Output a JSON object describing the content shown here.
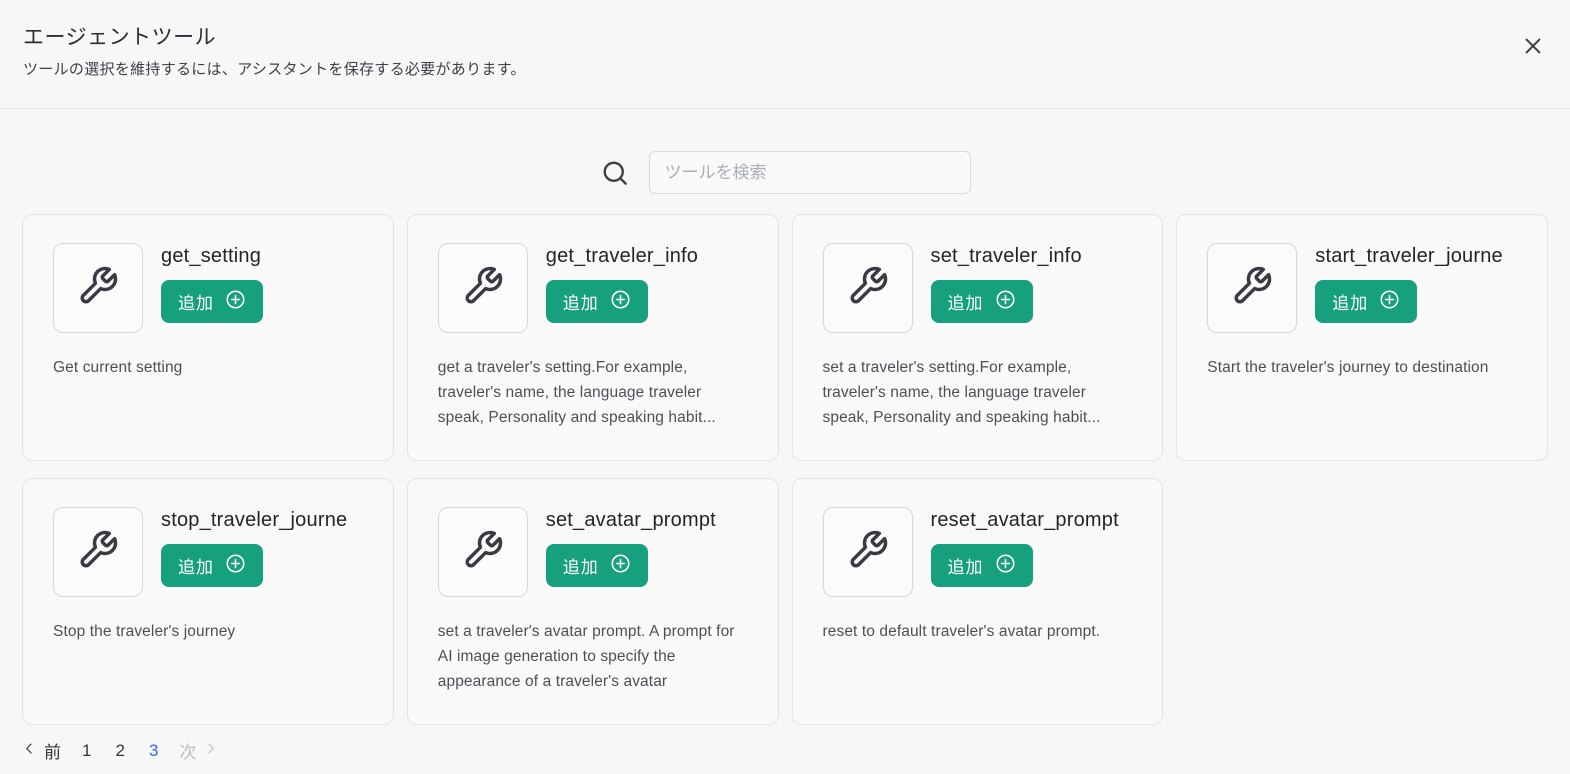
{
  "modal": {
    "title": "エージェントツール",
    "subtitle": "ツールの選択を維持するには、アシスタントを保存する必要があります。"
  },
  "search": {
    "placeholder": "ツールを検索"
  },
  "card": {
    "add_button_label": "追加"
  },
  "tools": [
    {
      "name": "get_setting",
      "description": "Get current setting"
    },
    {
      "name": "get_traveler_info",
      "description": "get a traveler's setting.For example, traveler's name, the language traveler speak, Personality and speaking habit..."
    },
    {
      "name": "set_traveler_info",
      "description": "set a traveler's setting.For example, traveler's name, the language traveler speak, Personality and speaking habit..."
    },
    {
      "name": "start_traveler_journe",
      "description": "Start the traveler's journey to destination"
    },
    {
      "name": "stop_traveler_journe",
      "description": "Stop the traveler's journey"
    },
    {
      "name": "set_avatar_prompt",
      "description": "set a traveler's avatar prompt. A prompt for AI image generation to specify the appearance of a traveler's avatar"
    },
    {
      "name": "reset_avatar_prompt",
      "description": "reset to default traveler's avatar prompt."
    }
  ],
  "pagination": {
    "prev_label": "前",
    "next_label": "次",
    "pages": [
      "1",
      "2",
      "3"
    ],
    "current_page": "3"
  },
  "colors": {
    "accent_green": "#17a07d",
    "active_page_blue": "#2e6be5",
    "page_background": "#f7f7f8"
  }
}
